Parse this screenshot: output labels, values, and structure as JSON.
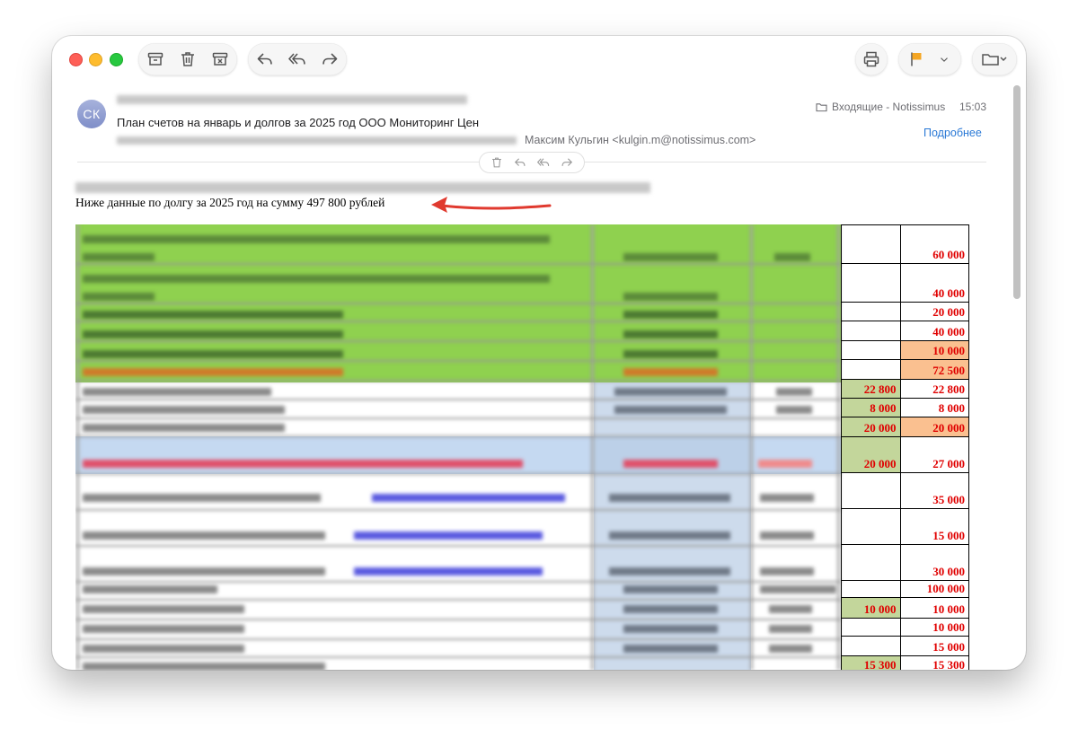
{
  "toolbar": {
    "icons": [
      "archive-icon",
      "trash-icon",
      "junk-icon",
      "reply-icon",
      "reply-all-icon",
      "forward-icon",
      "print-icon",
      "flag-icon",
      "chevron-down-icon",
      "move-to-folder-icon"
    ],
    "flag_color": "#f5a623"
  },
  "message": {
    "avatar_initials": "СК",
    "subject": "План счетов на январь и долгов за 2025 год ООО Мониторинг Цен",
    "from": "Максим Кульгин <kulgin.m@notissimus.com>",
    "mailbox": "Входящие - Notissimus",
    "time": "15:03",
    "details_link": "Подробнее"
  },
  "body": {
    "debt_line": "Ниже данные по долгу за 2025 год   на сумму 497 800 рублей",
    "arrow_color": "#e03a2f"
  },
  "table": {
    "rows": [
      {
        "c1": "",
        "c2": "60 000",
        "c1_bg": "",
        "c2_bg": ""
      },
      {
        "c1": "",
        "c2": "40 000",
        "c1_bg": "",
        "c2_bg": ""
      },
      {
        "c1": "",
        "c2": "20 000",
        "c1_bg": "",
        "c2_bg": ""
      },
      {
        "c1": "",
        "c2": "40 000",
        "c1_bg": "",
        "c2_bg": ""
      },
      {
        "c1": "",
        "c2": "10 000",
        "c1_bg": "",
        "c2_bg": "orange"
      },
      {
        "c1": "",
        "c2": "72 500",
        "c1_bg": "",
        "c2_bg": "orange"
      },
      {
        "c1": "22 800",
        "c2": "22 800",
        "c1_bg": "green",
        "c2_bg": ""
      },
      {
        "c1": "8 000",
        "c2": "8 000",
        "c1_bg": "green",
        "c2_bg": ""
      },
      {
        "c1": "20 000",
        "c2": "20 000",
        "c1_bg": "green",
        "c2_bg": "orange"
      },
      {
        "c1": "20 000",
        "c2": "27 000",
        "c1_bg": "green",
        "c2_bg": ""
      },
      {
        "c1": "",
        "c2": "35 000",
        "c1_bg": "",
        "c2_bg": ""
      },
      {
        "c1": "",
        "c2": "15 000",
        "c1_bg": "",
        "c2_bg": ""
      },
      {
        "c1": "",
        "c2": "30 000",
        "c1_bg": "",
        "c2_bg": ""
      },
      {
        "c1": "",
        "c2": "100 000",
        "c1_bg": "",
        "c2_bg": ""
      },
      {
        "c1": "10 000",
        "c2": "10 000",
        "c1_bg": "green",
        "c2_bg": ""
      },
      {
        "c1": "",
        "c2": "10 000",
        "c1_bg": "",
        "c2_bg": ""
      },
      {
        "c1": "",
        "c2": "15 000",
        "c1_bg": "",
        "c2_bg": ""
      },
      {
        "c1": "15 300",
        "c2": "15 300",
        "c1_bg": "green",
        "c2_bg": ""
      }
    ]
  }
}
